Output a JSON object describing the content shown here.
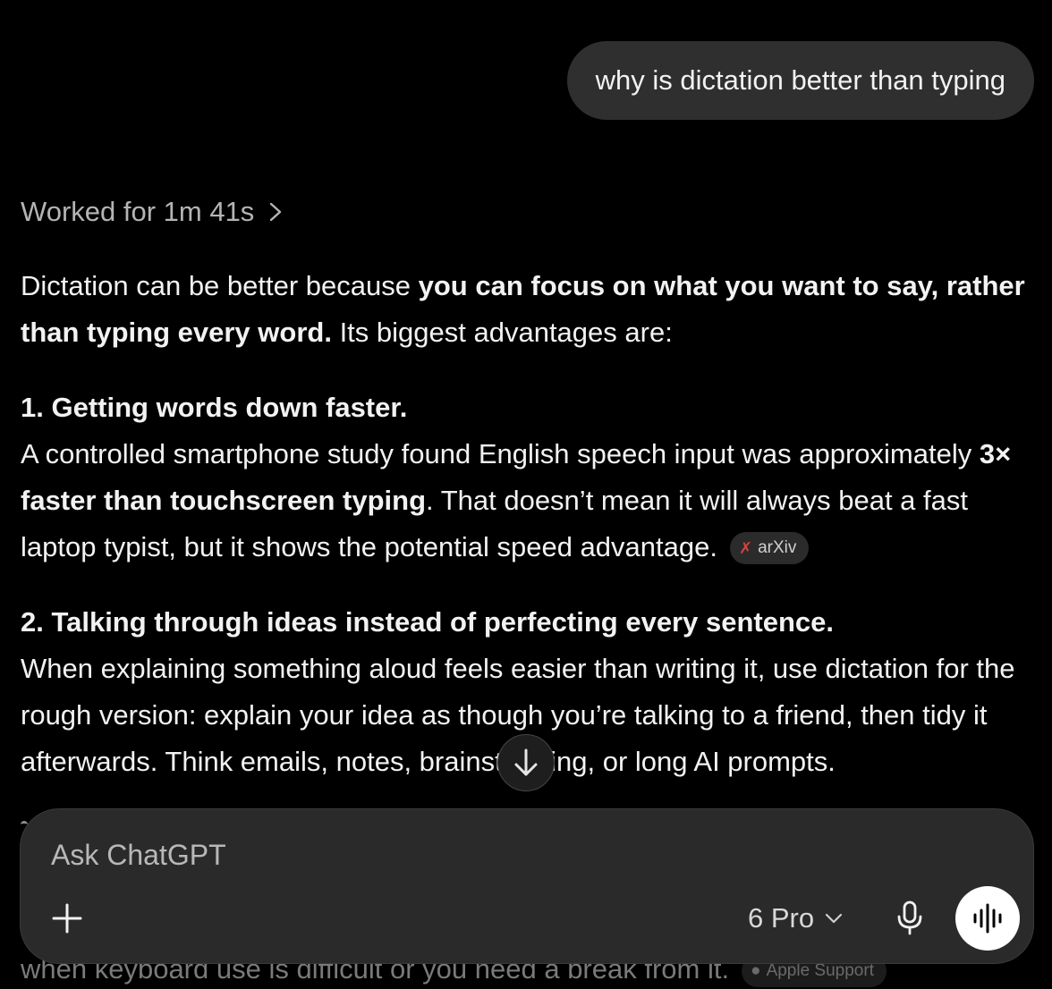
{
  "user_message": "why is dictation better than typing",
  "status": {
    "label": "Worked for 1m 41s",
    "icon": "chevron-right-icon"
  },
  "answer": {
    "intro": {
      "before": "Dictation can be better because ",
      "bold": "you can focus on what you want to say, rather than typing every word.",
      "after": " Its biggest advantages are:"
    },
    "points": [
      {
        "heading": "1. Getting words down faster.",
        "text_before": "A controlled smartphone study found English speech input was approximately ",
        "bold": "3× faster than touchscreen typing",
        "text_after": ". That doesn’t mean it will always beat a fast laptop typist, but it shows the potential speed advantage.",
        "citation": "arXiv"
      },
      {
        "heading": "2. Talking through ideas instead of perfecting every sentence.",
        "text": "When explaining something aloud feels easier than writing it, use dictation for the rough version: explain your idea as though you’re talking to a friend, then tidy it afterwards. Think emails, notes, brainstorming, or long AI prompts."
      }
    ],
    "partial_text": "when keyboard use is difficult or you need a break from it.",
    "partial_citation": "Apple Support"
  },
  "composer": {
    "placeholder": "Ask ChatGPT",
    "model": "6 Pro"
  },
  "colors": {
    "background": "#000000",
    "user_bubble": "#2f2f2f",
    "composer": "#2a2a2a",
    "citation_icon": "#d0453d"
  }
}
